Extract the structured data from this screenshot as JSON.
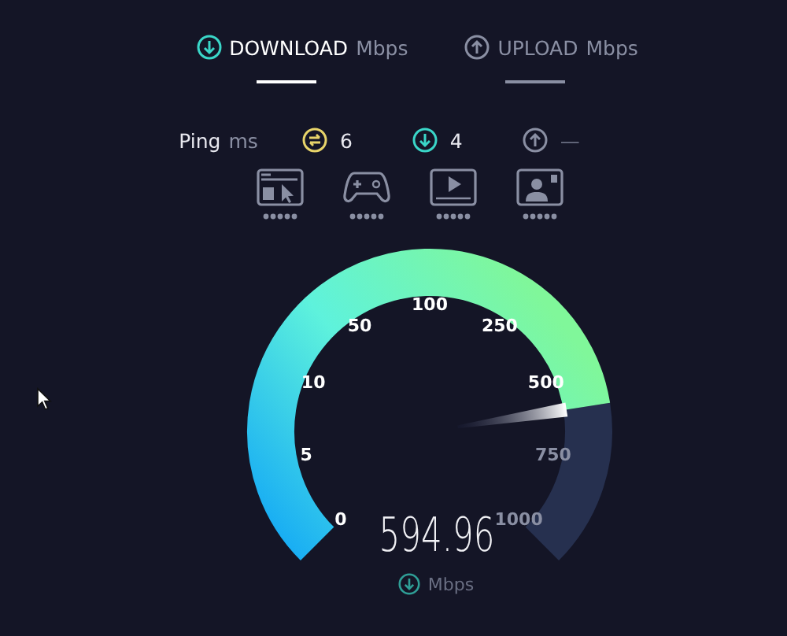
{
  "tabs": [
    {
      "label": "DOWNLOAD",
      "unit": "Mbps",
      "kind": "download",
      "selected": true
    },
    {
      "label": "UPLOAD",
      "unit": "Mbps",
      "kind": "upload",
      "selected": false
    }
  ],
  "ping": {
    "label": "Ping",
    "unit": "ms",
    "readings": [
      {
        "kind": "idle",
        "value": "6"
      },
      {
        "kind": "download",
        "value": "4"
      },
      {
        "kind": "upload",
        "value": "—"
      }
    ]
  },
  "gauge": {
    "ticks": [
      "0",
      "5",
      "10",
      "50",
      "100",
      "250",
      "500",
      "750",
      "1000"
    ],
    "value": "594.96",
    "unit": "Mbps"
  }
}
